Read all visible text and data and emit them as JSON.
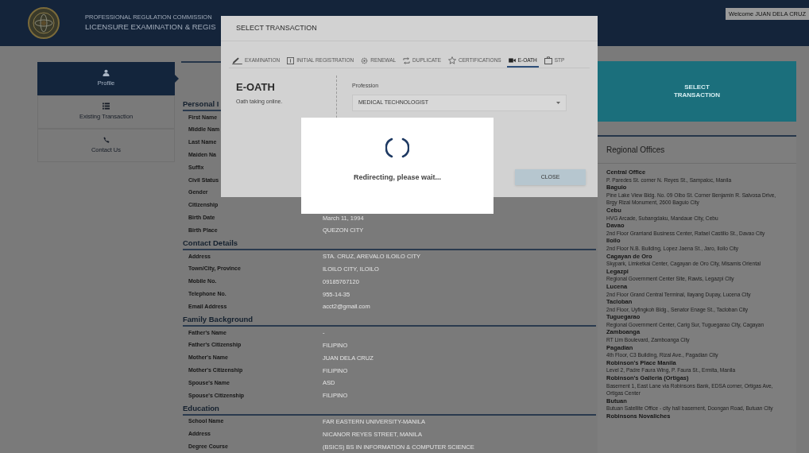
{
  "header": {
    "org": "PROFESSIONAL REGULATION COMMISSION",
    "system": "LICENSURE EXAMINATION & REGIS",
    "welcome": "Welcome JUAN DELA CRUZ"
  },
  "sidebar": {
    "items": [
      {
        "label": "Profile",
        "selected": true
      },
      {
        "label": "Existing Transaction",
        "selected": false
      },
      {
        "label": "Contact Us",
        "selected": false
      }
    ]
  },
  "profile": {
    "sections": [
      {
        "title": "Personal I",
        "rows": [
          {
            "label": "First Name"
          },
          {
            "label": "Middle Nam"
          },
          {
            "label": "Last Name"
          },
          {
            "label": "Maiden Na"
          },
          {
            "label": "Suffix"
          },
          {
            "label": "Civil Status"
          },
          {
            "label": "Gender"
          },
          {
            "label": "Citizenship"
          },
          {
            "label": "Birth Date",
            "value": "March 11, 1994"
          },
          {
            "label": "Birth Place",
            "value": "QUEZON CITY"
          }
        ]
      },
      {
        "title": "Contact Details",
        "rows": [
          {
            "label": "Address",
            "value": "STA. CRUZ, AREVALO ILOILO CITY"
          },
          {
            "label": "Town/City, Province",
            "value": "ILOILO CITY, ILOILO"
          },
          {
            "label": "Mobile No.",
            "value": "09185767120"
          },
          {
            "label": "Telephone No.",
            "value": "955-14-35"
          },
          {
            "label": "Email Address",
            "value": "acct2@gmail.com"
          }
        ]
      },
      {
        "title": "Family Background",
        "rows": [
          {
            "label": "Father's Name",
            "value": "-"
          },
          {
            "label": "Father's Citizenship",
            "value": "FILIPINO"
          },
          {
            "label": "Mother's Name",
            "value": "JUAN DELA CRUZ"
          },
          {
            "label": "Mother's Citizenship",
            "value": "FILIPINO"
          },
          {
            "label": "Spouse's Name",
            "value": "ASD"
          },
          {
            "label": "Spouse's Citizenship",
            "value": "FILIPINO"
          }
        ]
      },
      {
        "title": "Education",
        "rows": [
          {
            "label": "School Name",
            "value": "FAR EASTERN UNIVERSITY-MANILA"
          },
          {
            "label": "Address",
            "value": "NICANOR REYES STREET, MANILA"
          },
          {
            "label": "Degree Course",
            "value": "(BSICS) BS IN INFORMATION & COMPUTER SCIENCE"
          }
        ]
      }
    ]
  },
  "select_card": {
    "label": "SELECT TRANSACTION"
  },
  "regional_offices": {
    "title": "Regional Offices",
    "offices": [
      {
        "name": "Central Office",
        "address": "P. Paredes St. corner N. Reyes St., Sampaloc, Manila"
      },
      {
        "name": "Baguio",
        "address": "Pine Lake View Bldg. No. 09 Olbo St. Corner Benjamin R. Salvosa Drive, Brgy Rizal Monument, 2600 Baguio City"
      },
      {
        "name": "Cebu",
        "address": "HVG Arcade, Subangdaku, Mandaue City, Cebu"
      },
      {
        "name": "Davao",
        "address": "2nd Floor Grarriand Business Center, Rafael Castillo St., Davao City"
      },
      {
        "name": "Iloilo",
        "address": "2nd Floor N.B. Building, Lopez Jaena St., Jaro, Iloilo City"
      },
      {
        "name": "Cagayan de Oro",
        "address": "Skypark, Limketkai Center, Cagayan de Oro City, Misamis Oriental"
      },
      {
        "name": "Legazpi",
        "address": "Regional Government Center Site, Rawis, Legazpi City"
      },
      {
        "name": "Lucena",
        "address": "2nd Floor Grand Central Terminal, Ilayang Dupay, Lucena City"
      },
      {
        "name": "Tacloban",
        "address": "2nd Floor, Uyfingkoh Bldg., Senator Enage St., Tacloban City"
      },
      {
        "name": "Tuguegarao",
        "address": "Regional Government Center, Carig Sur, Tuguegarao City, Cagayan"
      },
      {
        "name": "Zamboanga",
        "address": "RT Lim Boulevard, Zamboanga City"
      },
      {
        "name": "Pagadian",
        "address": "4th Floor, C3 Building, Rizal Ave., Pagadian City"
      },
      {
        "name": "Robinson's Place Manila",
        "address": "Level 2, Padre Faura Wing, P. Faura St., Ermita, Manila"
      },
      {
        "name": "Robinson's Galleria (Ortigas)",
        "address": "Basement 1, East Lane via Robinsons Bank, EDSA corner, Ortigas Ave, Ortigas Center"
      },
      {
        "name": "Butuan",
        "address": "Butuan Satellite Office - city hall basement, Doongan Road, Butuan City"
      },
      {
        "name": "Robinsons Novaliches"
      }
    ]
  },
  "modal": {
    "title": "SELECT TRANSACTION",
    "tabs": [
      {
        "label": "EXAMINATION",
        "selected": false
      },
      {
        "label": "INITIAL REGISTRATION",
        "selected": false
      },
      {
        "label": "RENEWAL",
        "selected": false
      },
      {
        "label": "DUPLICATE",
        "selected": false
      },
      {
        "label": "CERTIFICATIONS",
        "selected": false
      },
      {
        "label": "E-OATH",
        "selected": true
      },
      {
        "label": "STP",
        "selected": false
      }
    ],
    "transaction": {
      "title": "E-OATH",
      "description": "Oath taking online."
    },
    "profession": {
      "label": "Profession",
      "value": "MEDICAL TECHNOLOGIST"
    },
    "close": "CLOSE"
  },
  "loading": {
    "message": "Redirecting, please wait..."
  }
}
